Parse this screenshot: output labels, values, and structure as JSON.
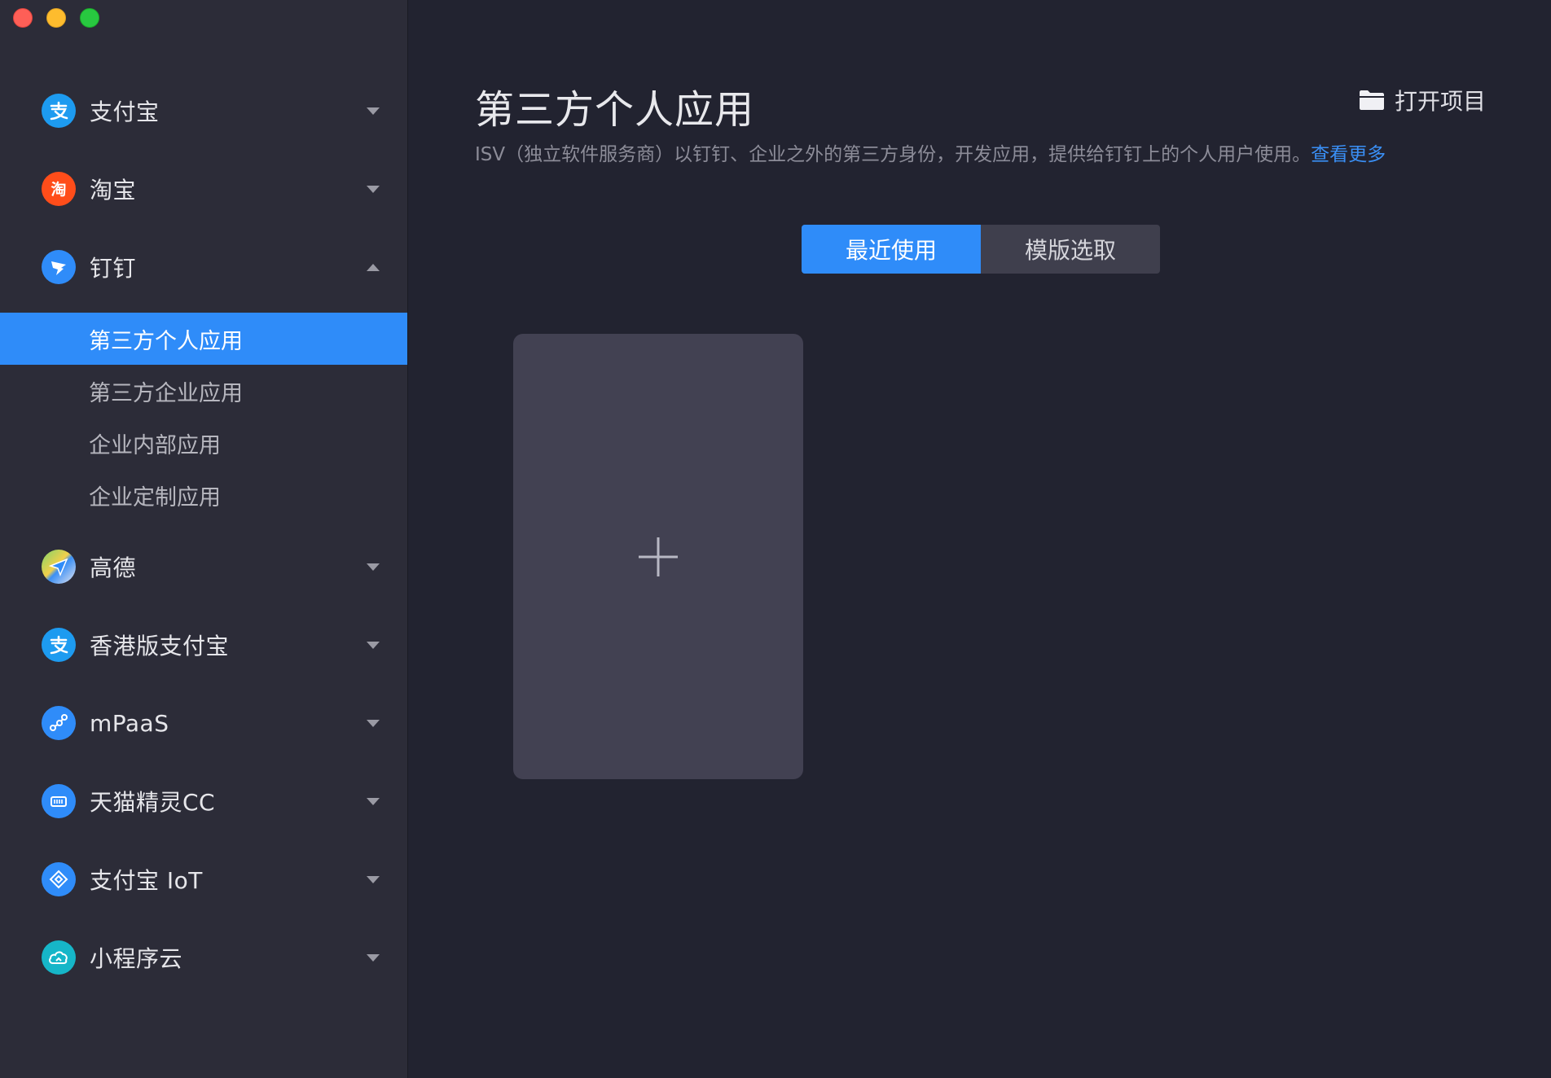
{
  "window": {
    "controls": [
      "close",
      "minimize",
      "zoom"
    ]
  },
  "sidebar": {
    "groups": [
      {
        "label": "支付宝",
        "icon": "alipay-icon",
        "icon_color": "#1d9bf0",
        "expanded": false
      },
      {
        "label": "淘宝",
        "icon": "taobao-icon",
        "icon_color": "#ff4d1a",
        "expanded": false
      },
      {
        "label": "钉钉",
        "icon": "dingtalk-icon",
        "icon_color": "#2f8cf9",
        "expanded": true
      },
      {
        "label": "高德",
        "icon": "amap-icon",
        "icon_color": "#3a8ff5",
        "expanded": false
      },
      {
        "label": "香港版支付宝",
        "icon": "alipayhk-icon",
        "icon_color": "#1d9bf0",
        "expanded": false
      },
      {
        "label": "mPaaS",
        "icon": "mpaas-icon",
        "icon_color": "#2f8cf9",
        "expanded": false
      },
      {
        "label": "天猫精灵CC",
        "icon": "tmall-genie-icon",
        "icon_color": "#2f8cf9",
        "expanded": false
      },
      {
        "label": "支付宝 IoT",
        "icon": "alipay-iot-icon",
        "icon_color": "#2f8cf9",
        "expanded": false
      },
      {
        "label": "小程序云",
        "icon": "cloud-icon",
        "icon_color": "#16b6c8",
        "expanded": false
      }
    ],
    "dingtalk_subitems": [
      {
        "label": "第三方个人应用",
        "active": true
      },
      {
        "label": "第三方企业应用",
        "active": false
      },
      {
        "label": "企业内部应用",
        "active": false
      },
      {
        "label": "企业定制应用",
        "active": false
      }
    ]
  },
  "main": {
    "title": "第三方个人应用",
    "open_project_label": "打开项目",
    "description": "ISV（独立软件服务商）以钉钉、企业之外的第三方身份，开发应用，提供给钉钉上的个人用户使用。",
    "learn_more": "查看更多",
    "tabs": [
      {
        "label": "最近使用",
        "active": true
      },
      {
        "label": "模版选取",
        "active": false
      }
    ],
    "add_card_icon": "plus-icon"
  },
  "colors": {
    "accent": "#2f8cf9",
    "background": "#222330",
    "sidebar": "#2c2c38",
    "card": "#424152",
    "link": "#3a8ff5"
  }
}
